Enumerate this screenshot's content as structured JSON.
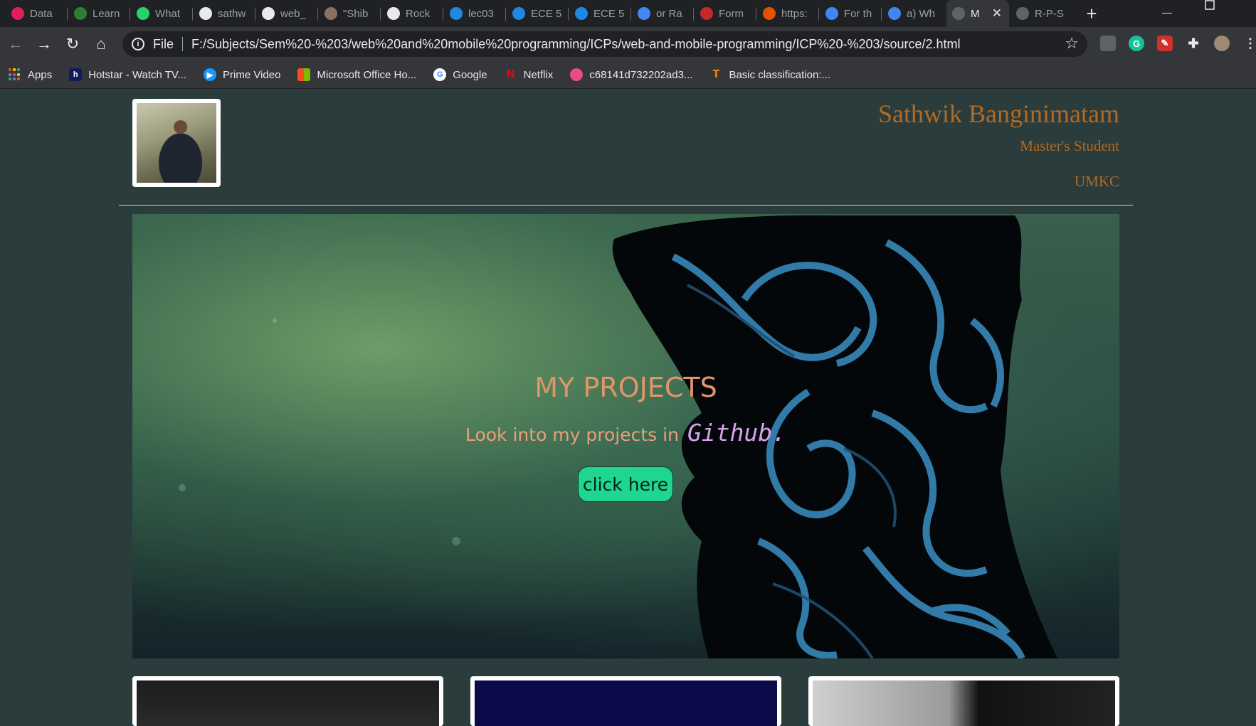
{
  "browser": {
    "tabs": [
      {
        "label": "Data",
        "icon": "slack-icon",
        "color": "#e01e5a"
      },
      {
        "label": "Learn",
        "icon": "learn-icon",
        "color": "#2e7d32"
      },
      {
        "label": "What",
        "icon": "whatsapp-icon",
        "color": "#25d366"
      },
      {
        "label": "sathw",
        "icon": "github-icon",
        "color": "#e8eaed"
      },
      {
        "label": "web_",
        "icon": "github-icon",
        "color": "#e8eaed"
      },
      {
        "label": "\"Shib",
        "icon": "shiba-icon",
        "color": "#8d6e63"
      },
      {
        "label": "Rock",
        "icon": "wikipedia-icon",
        "color": "#e8eaed"
      },
      {
        "label": "lec03",
        "icon": "canvas-icon",
        "color": "#1e88e5"
      },
      {
        "label": "ECE 5",
        "icon": "canvas-icon",
        "color": "#1e88e5"
      },
      {
        "label": "ECE 5",
        "icon": "canvas-icon",
        "color": "#1e88e5"
      },
      {
        "label": "or Ra",
        "icon": "google-icon",
        "color": "#4285f4"
      },
      {
        "label": "Form",
        "icon": "form-icon",
        "color": "#c62828"
      },
      {
        "label": "https:",
        "icon": "shield-icon",
        "color": "#e65100"
      },
      {
        "label": "For th",
        "icon": "google-icon",
        "color": "#4285f4"
      },
      {
        "label": "a) Wh",
        "icon": "google-icon",
        "color": "#4285f4"
      },
      {
        "label": "M",
        "icon": "globe-icon",
        "color": "#5f6368"
      },
      {
        "label": "R-P-S",
        "icon": "globe-icon",
        "color": "#5f6368"
      }
    ],
    "active_tab_index": 15,
    "address": {
      "scheme_label": "File",
      "url": "F:/Subjects/Sem%20-%203/web%20and%20mobile%20programming/ICPs/web-and-mobile-programming/ICP%20-%203/source/2.html"
    },
    "bookmarks": [
      {
        "label": "Apps",
        "icon": "apps-grid-icon"
      },
      {
        "label": "Hotstar - Watch TV...",
        "icon": "hotstar-icon",
        "color": "#0f1c5c"
      },
      {
        "label": "Prime Video",
        "icon": "prime-video-icon",
        "color": "#1a98ff"
      },
      {
        "label": "Microsoft Office Ho...",
        "icon": "microsoft-icon",
        "color": "#f25022"
      },
      {
        "label": "Google",
        "icon": "google-icon",
        "color": "#4285f4"
      },
      {
        "label": "Netflix",
        "icon": "netflix-icon",
        "color": "#e50914"
      },
      {
        "label": "c68141d732202ad3...",
        "icon": "dribbble-icon",
        "color": "#ea4c89"
      },
      {
        "label": "Basic classification:...",
        "icon": "tensorflow-icon",
        "color": "#ff8f00"
      }
    ]
  },
  "header": {
    "name": "Sathwik Banginimatam",
    "role": "Master's Student",
    "org": "UMKC"
  },
  "hero": {
    "title": "MY PROJECTS",
    "subtitle_prefix": "Look into my projects in",
    "subtitle_link": "Github.",
    "button_label": "click here"
  },
  "colors": {
    "page_bg": "#2b3c3c",
    "header_text": "#b36a22",
    "hero_title": "#e0956a",
    "github_text": "#d6a3e8",
    "button_bg": "#1ed68f"
  }
}
